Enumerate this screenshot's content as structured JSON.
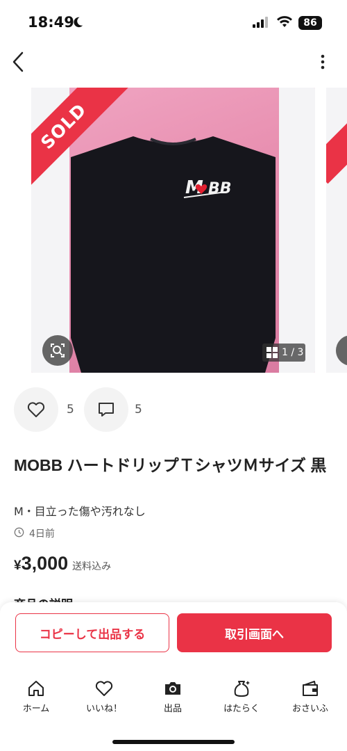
{
  "status_bar": {
    "time": "18:49",
    "battery": "86"
  },
  "photo": {
    "sold_label": "SOLD",
    "counter": "1 / 3"
  },
  "actions": {
    "likes": "5",
    "comments": "5"
  },
  "item": {
    "title": "MOBB ハートドリップＴシャツＭサイズ 黒",
    "condition": "M・目立った傷や汚れなし",
    "posted": "4日前",
    "price_symbol": "¥",
    "price": "3,000",
    "shipping": "送料込み",
    "description_heading": "商品の説明"
  },
  "buttons": {
    "copy": "コピーして出品する",
    "trade": "取引画面へ"
  },
  "tabbar": [
    {
      "label": "ホーム",
      "icon": "home-icon"
    },
    {
      "label": "いいね！",
      "icon": "heart-icon"
    },
    {
      "label": "出品",
      "icon": "camera-icon"
    },
    {
      "label": "はたらく",
      "icon": "moneybag-icon"
    },
    {
      "label": "おさいふ",
      "icon": "wallet-icon"
    }
  ],
  "colors": {
    "accent": "#ea3346"
  }
}
